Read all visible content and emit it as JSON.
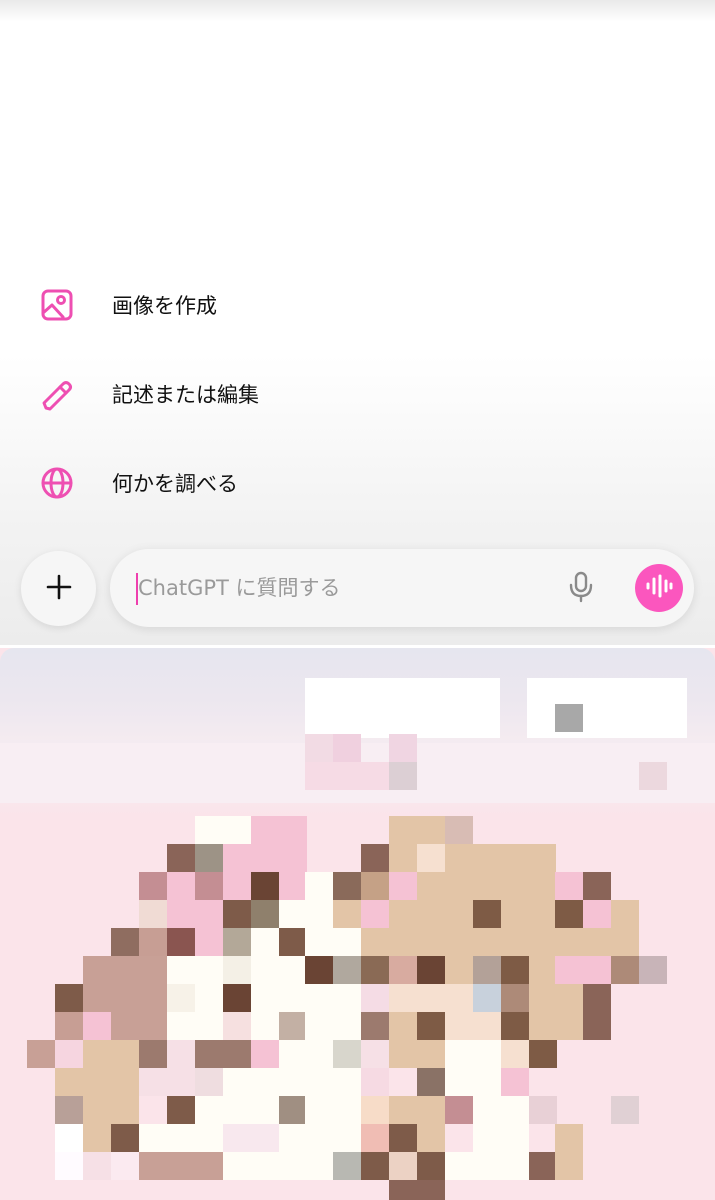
{
  "suggestions": [
    {
      "label": "画像を作成",
      "icon": "image-icon"
    },
    {
      "label": "記述または編集",
      "icon": "pencil-icon"
    },
    {
      "label": "何かを調べる",
      "icon": "globe-icon"
    }
  ],
  "composer": {
    "placeholder": "ChatGPT に質問する",
    "plus_icon": "plus-icon",
    "mic_icon": "microphone-icon",
    "voice_icon": "voice-waveform-icon"
  },
  "colors": {
    "accent": "#fb56be",
    "icon_pink": "#ee4fb2",
    "text": "#111111",
    "placeholder": "#9a9a9a",
    "composer_bg": "#f6f6f6"
  }
}
